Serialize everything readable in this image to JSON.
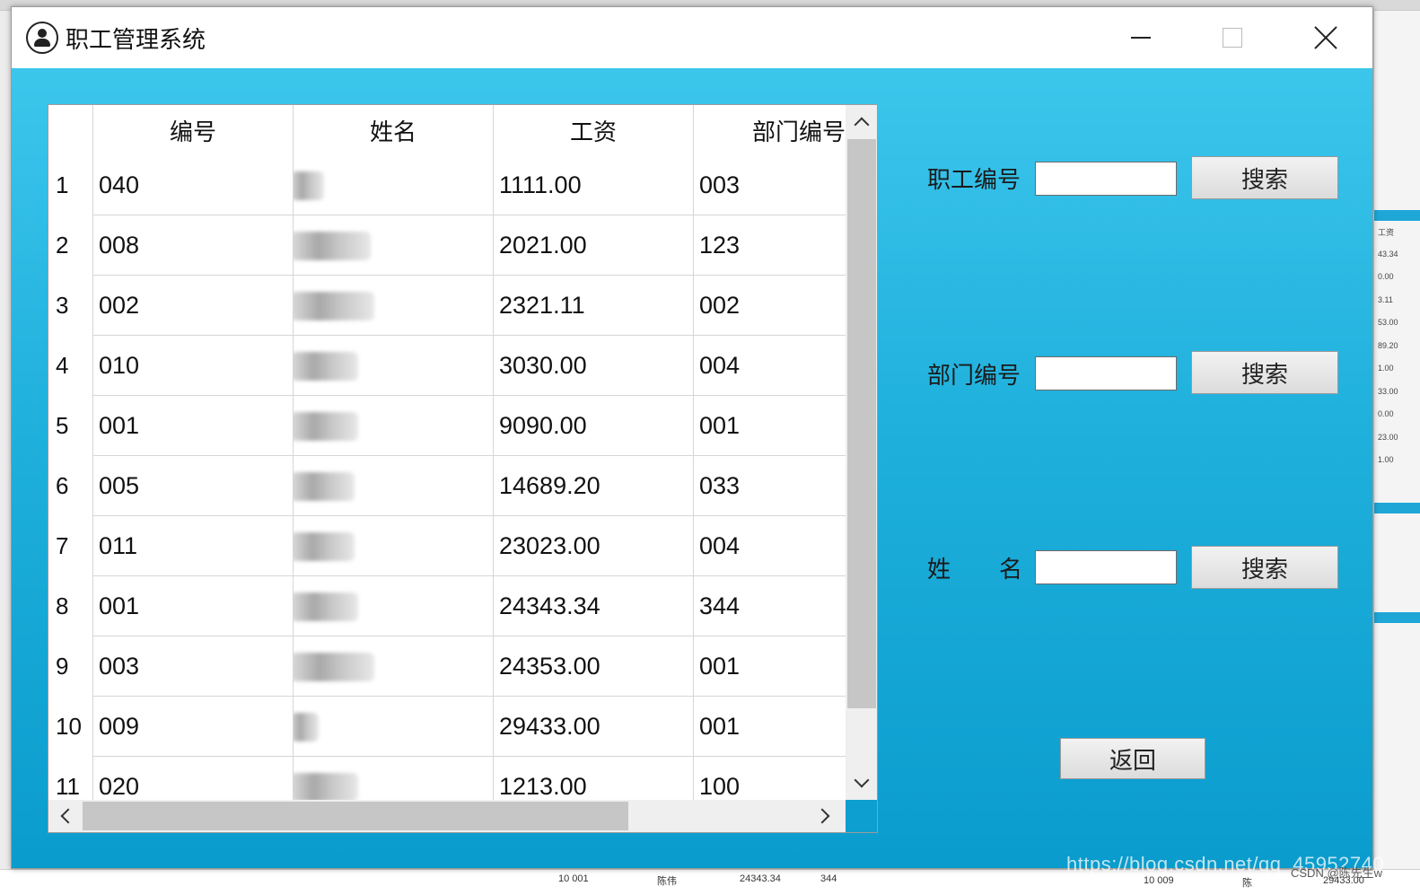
{
  "window": {
    "title": "职工管理系统"
  },
  "table": {
    "headers": [
      "编号",
      "姓名",
      "工资",
      "部门编号"
    ],
    "rows": [
      {
        "num": "1",
        "id": "040",
        "salary": "1111.00",
        "dept": "003"
      },
      {
        "num": "2",
        "id": "008",
        "salary": "2021.00",
        "dept": "123"
      },
      {
        "num": "3",
        "id": "002",
        "salary": "2321.11",
        "dept": "002"
      },
      {
        "num": "4",
        "id": "010",
        "salary": "3030.00",
        "dept": "004"
      },
      {
        "num": "5",
        "id": "001",
        "salary": "9090.00",
        "dept": "001"
      },
      {
        "num": "6",
        "id": "005",
        "salary": "14689.20",
        "dept": "033"
      },
      {
        "num": "7",
        "id": "011",
        "salary": "23023.00",
        "dept": "004"
      },
      {
        "num": "8",
        "id": "001",
        "salary": "24343.34",
        "dept": "344"
      },
      {
        "num": "9",
        "id": "003",
        "salary": "24353.00",
        "dept": "001"
      },
      {
        "num": "10",
        "id": "009",
        "salary": "29433.00",
        "dept": "001"
      },
      {
        "num": "11",
        "id": "020",
        "salary": "1213.00",
        "dept": "100"
      }
    ]
  },
  "search": {
    "employee_id_label": "职工编号",
    "dept_id_label": "部门编号",
    "name_label_1": "姓",
    "name_label_2": "名",
    "button_label": "搜索",
    "back_label": "返回",
    "employee_id_value": "",
    "dept_id_value": "",
    "name_value": ""
  },
  "background": {
    "right_numbers": [
      "工资",
      "43.34",
      "0.00",
      "3.11",
      "53.00",
      "89.20",
      "1.00",
      "33.00",
      "0.00",
      "23.00",
      "1.00"
    ],
    "bottom_row_a": [
      "10 001",
      "陈伟",
      "24343.34",
      "344"
    ],
    "bottom_row_b": [
      "10 009",
      "陈",
      "29433.00"
    ],
    "watermark": "https://blog.csdn.net/qq_45952740",
    "watermark_2": "CSDN @陈先生w"
  },
  "colors": {
    "client_top": "#3cc6ec",
    "client_bottom": "#0a9ccd",
    "title_bg": "#ffffff"
  }
}
